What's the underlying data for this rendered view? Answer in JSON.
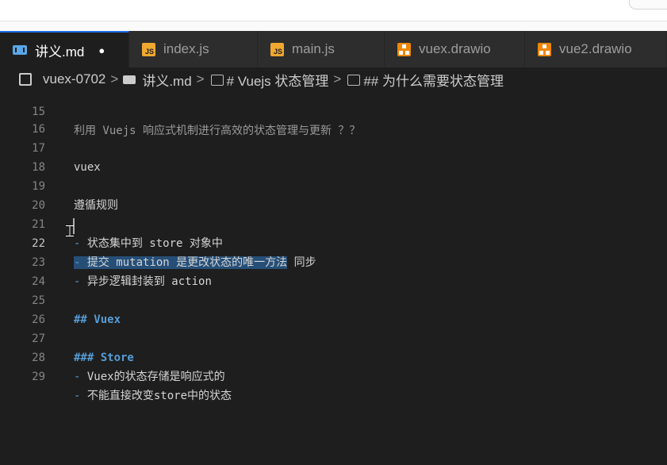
{
  "tabs": [
    {
      "label": "讲义.md",
      "icon": "markdown-icon",
      "active": true,
      "dirty": true
    },
    {
      "label": "index.js",
      "icon": "js-icon"
    },
    {
      "label": "main.js",
      "icon": "js-icon"
    },
    {
      "label": "vuex.drawio",
      "icon": "drawio-icon"
    },
    {
      "label": "vue2.drawio",
      "icon": "drawio-icon"
    }
  ],
  "breadcrumb": {
    "folder": "vuex-0702",
    "file": "讲义.md",
    "h1": "# Vuejs 状态管理",
    "h2": "## 为什么需要状态管理",
    "separator": ">"
  },
  "dirty_marker": "●",
  "lines": [
    {
      "num": "15",
      "text": "利用 Vuejs 响应式机制进行高效的状态管理与更新 ？？"
    },
    {
      "num": "16",
      "text": ""
    },
    {
      "num": "17",
      "text": "vuex"
    },
    {
      "num": "18",
      "text": ""
    },
    {
      "num": "19",
      "text": "遵循规则"
    },
    {
      "num": "20",
      "text": ""
    },
    {
      "num": "21",
      "dash": "-",
      "text": " 状态集中到 store 对象中"
    },
    {
      "num": "22",
      "dash": "-",
      "text": " 提交 mutation 是更改状态的唯一方法",
      "rest": " 同步"
    },
    {
      "num": "23",
      "dash": "-",
      "text": " 异步逻辑封装到 action"
    },
    {
      "num": "24",
      "text": ""
    },
    {
      "num": "25",
      "text": "## Vuex"
    },
    {
      "num": "26",
      "text": ""
    },
    {
      "num": "27",
      "text": "### Store"
    },
    {
      "num": "28",
      "dash": "-",
      "text": " Vuex的状态存储是响应式的"
    },
    {
      "num": "29",
      "dash": "-",
      "text": " 不能直接改变store中的状态"
    }
  ],
  "colors": {
    "accent": "#1f6feb",
    "selection": "#264f78",
    "heading": "#569cd6"
  }
}
